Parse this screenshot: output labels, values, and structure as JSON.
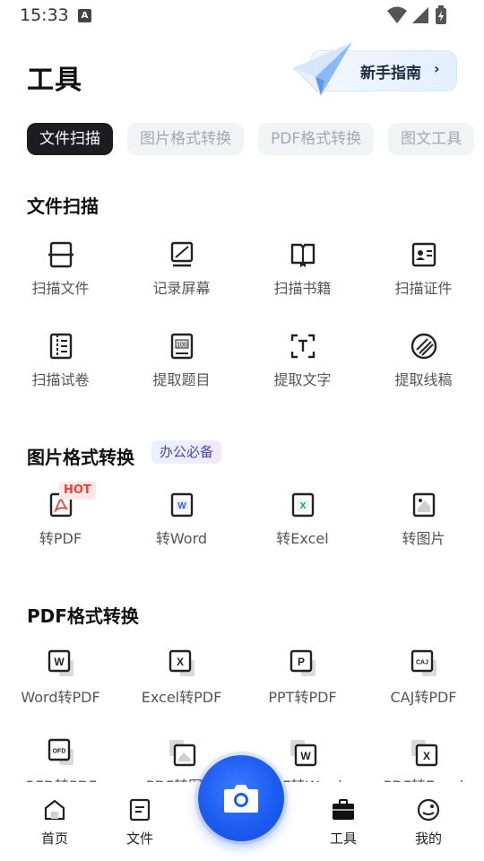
{
  "status": {
    "time": "15:33",
    "notif_letter": "A"
  },
  "header": {
    "title": "工具",
    "guide_label": "新手指南",
    "guide_chevron": "›"
  },
  "chips": [
    "文件扫描",
    "图片格式转换",
    "PDF格式转换",
    "图文工具"
  ],
  "sections": {
    "scan": {
      "title": "文件扫描",
      "row1": [
        "扫描文件",
        "记录屏幕",
        "扫描书籍",
        "扫描证件"
      ],
      "row2": [
        "扫描试卷",
        "提取题目",
        "提取文字",
        "提取线稿"
      ]
    },
    "image": {
      "title": "图片格式转换",
      "badge": "办公必备",
      "hot": "HOT",
      "items": [
        "转PDF",
        "转Word",
        "转Excel",
        "转图片"
      ]
    },
    "pdf": {
      "title": "PDF格式转换",
      "row1": [
        "Word转PDF",
        "Excel转PDF",
        "PPT转PDF",
        "CAJ转PDF"
      ],
      "row2": [
        "OFD转PDF",
        "PDF转图片",
        "PDF转Word",
        "PDF转Excel"
      ]
    }
  },
  "icon_glyphs": {
    "word": "W",
    "excel": "X",
    "ppt": "P",
    "caj": "CAJ",
    "ofd": "OFD",
    "exam": "100"
  },
  "bottom_nav": {
    "home": "首页",
    "files": "文件",
    "tools": "工具",
    "mine": "我的"
  },
  "colors": {
    "accent": "#1c5cf0",
    "hot": "#e6433c",
    "chip_active": "#1d1d1f",
    "excel_green": "#1f9d55",
    "word_blue": "#2b5fd9",
    "pdf_red": "#e6433c"
  }
}
